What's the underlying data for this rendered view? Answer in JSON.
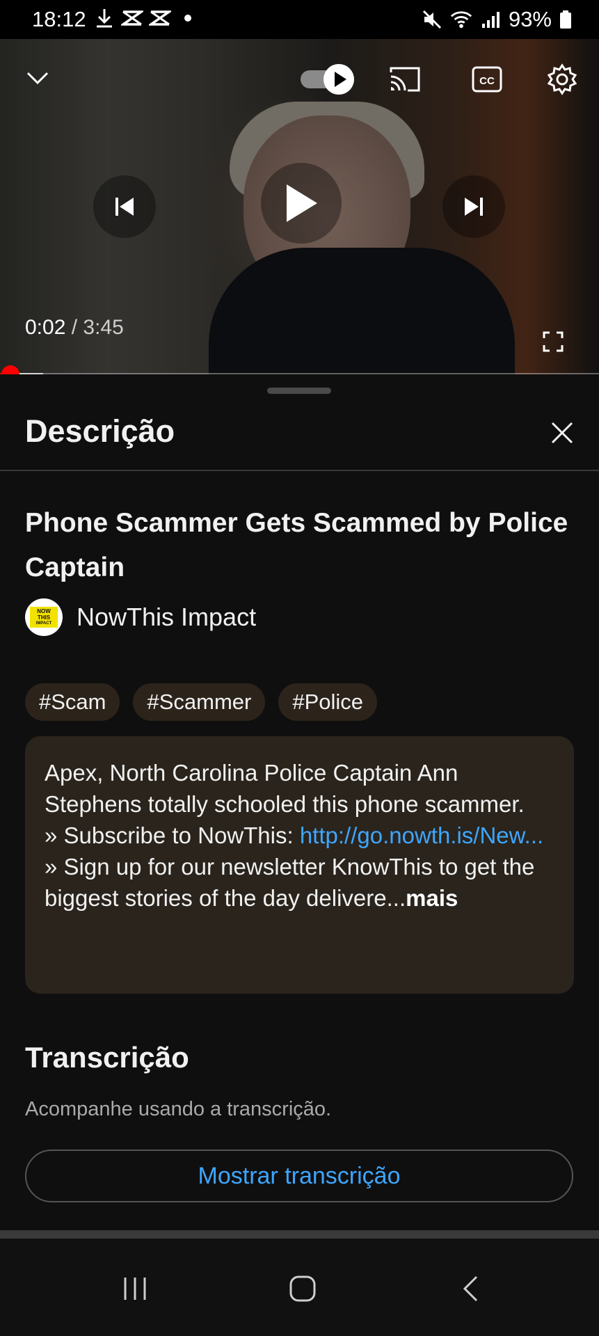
{
  "status_bar": {
    "time": "18:12",
    "battery": "93%"
  },
  "player": {
    "current_time": "0:02",
    "separator": " / ",
    "duration": "3:45",
    "progress_fraction": 0.009,
    "buffer_fraction": 0.072,
    "accent_color": "#ff0000"
  },
  "sheet": {
    "title": "Descrição"
  },
  "video": {
    "title": "Phone Scammer Gets Scammed by Police Captain",
    "channel": {
      "name": "NowThis Impact",
      "avatar_line1": "NOW",
      "avatar_line2": "THIS",
      "avatar_line3": "IMPACT"
    },
    "hashtags": [
      "#Scam",
      "#Scammer",
      "#Police"
    ],
    "description": {
      "line1": "Apex, North Carolina Police Captain Ann Stephens totally schooled this phone scammer.",
      "subscribe_prefix": "» Subscribe to NowThis: ",
      "subscribe_link": "http://go.nowth.is/New...",
      "newsletter": "» Sign up for our newsletter KnowThis to get the biggest stories of the day delivere...",
      "more_label": "mais"
    }
  },
  "transcript": {
    "title": "Transcrição",
    "subtitle": "Acompanhe usando a transcrição.",
    "button_label": "Mostrar transcrição"
  },
  "colors": {
    "background": "#0f0f0f",
    "link": "#3ea6ff",
    "chip_bg": "#2c241b",
    "description_bg": "#2a241c"
  }
}
